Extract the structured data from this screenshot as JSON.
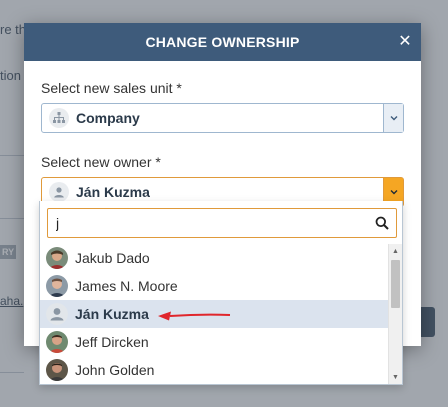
{
  "background": {
    "fragment_1": "re th",
    "fragment_2": "tion",
    "badge": "RY",
    "fragment_3": "aha."
  },
  "modal": {
    "title": "CHANGE OWNERSHIP",
    "close_glyph": "✕",
    "sales_unit": {
      "label": "Select new sales unit *",
      "value": "Company",
      "icon": "org-chart-icon"
    },
    "owner": {
      "label": "Select new owner *",
      "value": "Ján Kuzma",
      "icon": "user-icon"
    }
  },
  "dropdown": {
    "search_value": "j",
    "items": [
      {
        "name": "Jakub Dado",
        "avatar": "photo"
      },
      {
        "name": "James N. Moore",
        "avatar": "photo"
      },
      {
        "name": "Ján Kuzma",
        "avatar": "user-icon",
        "selected": true
      },
      {
        "name": "Jeff Dircken",
        "avatar": "photo"
      },
      {
        "name": "John Golden",
        "avatar": "photo"
      }
    ]
  },
  "colors": {
    "header": "#3e5b7b",
    "accent_orange": "#f5a623",
    "annotation_arrow": "#e0262c",
    "selected_row": "#dbe3ee"
  }
}
